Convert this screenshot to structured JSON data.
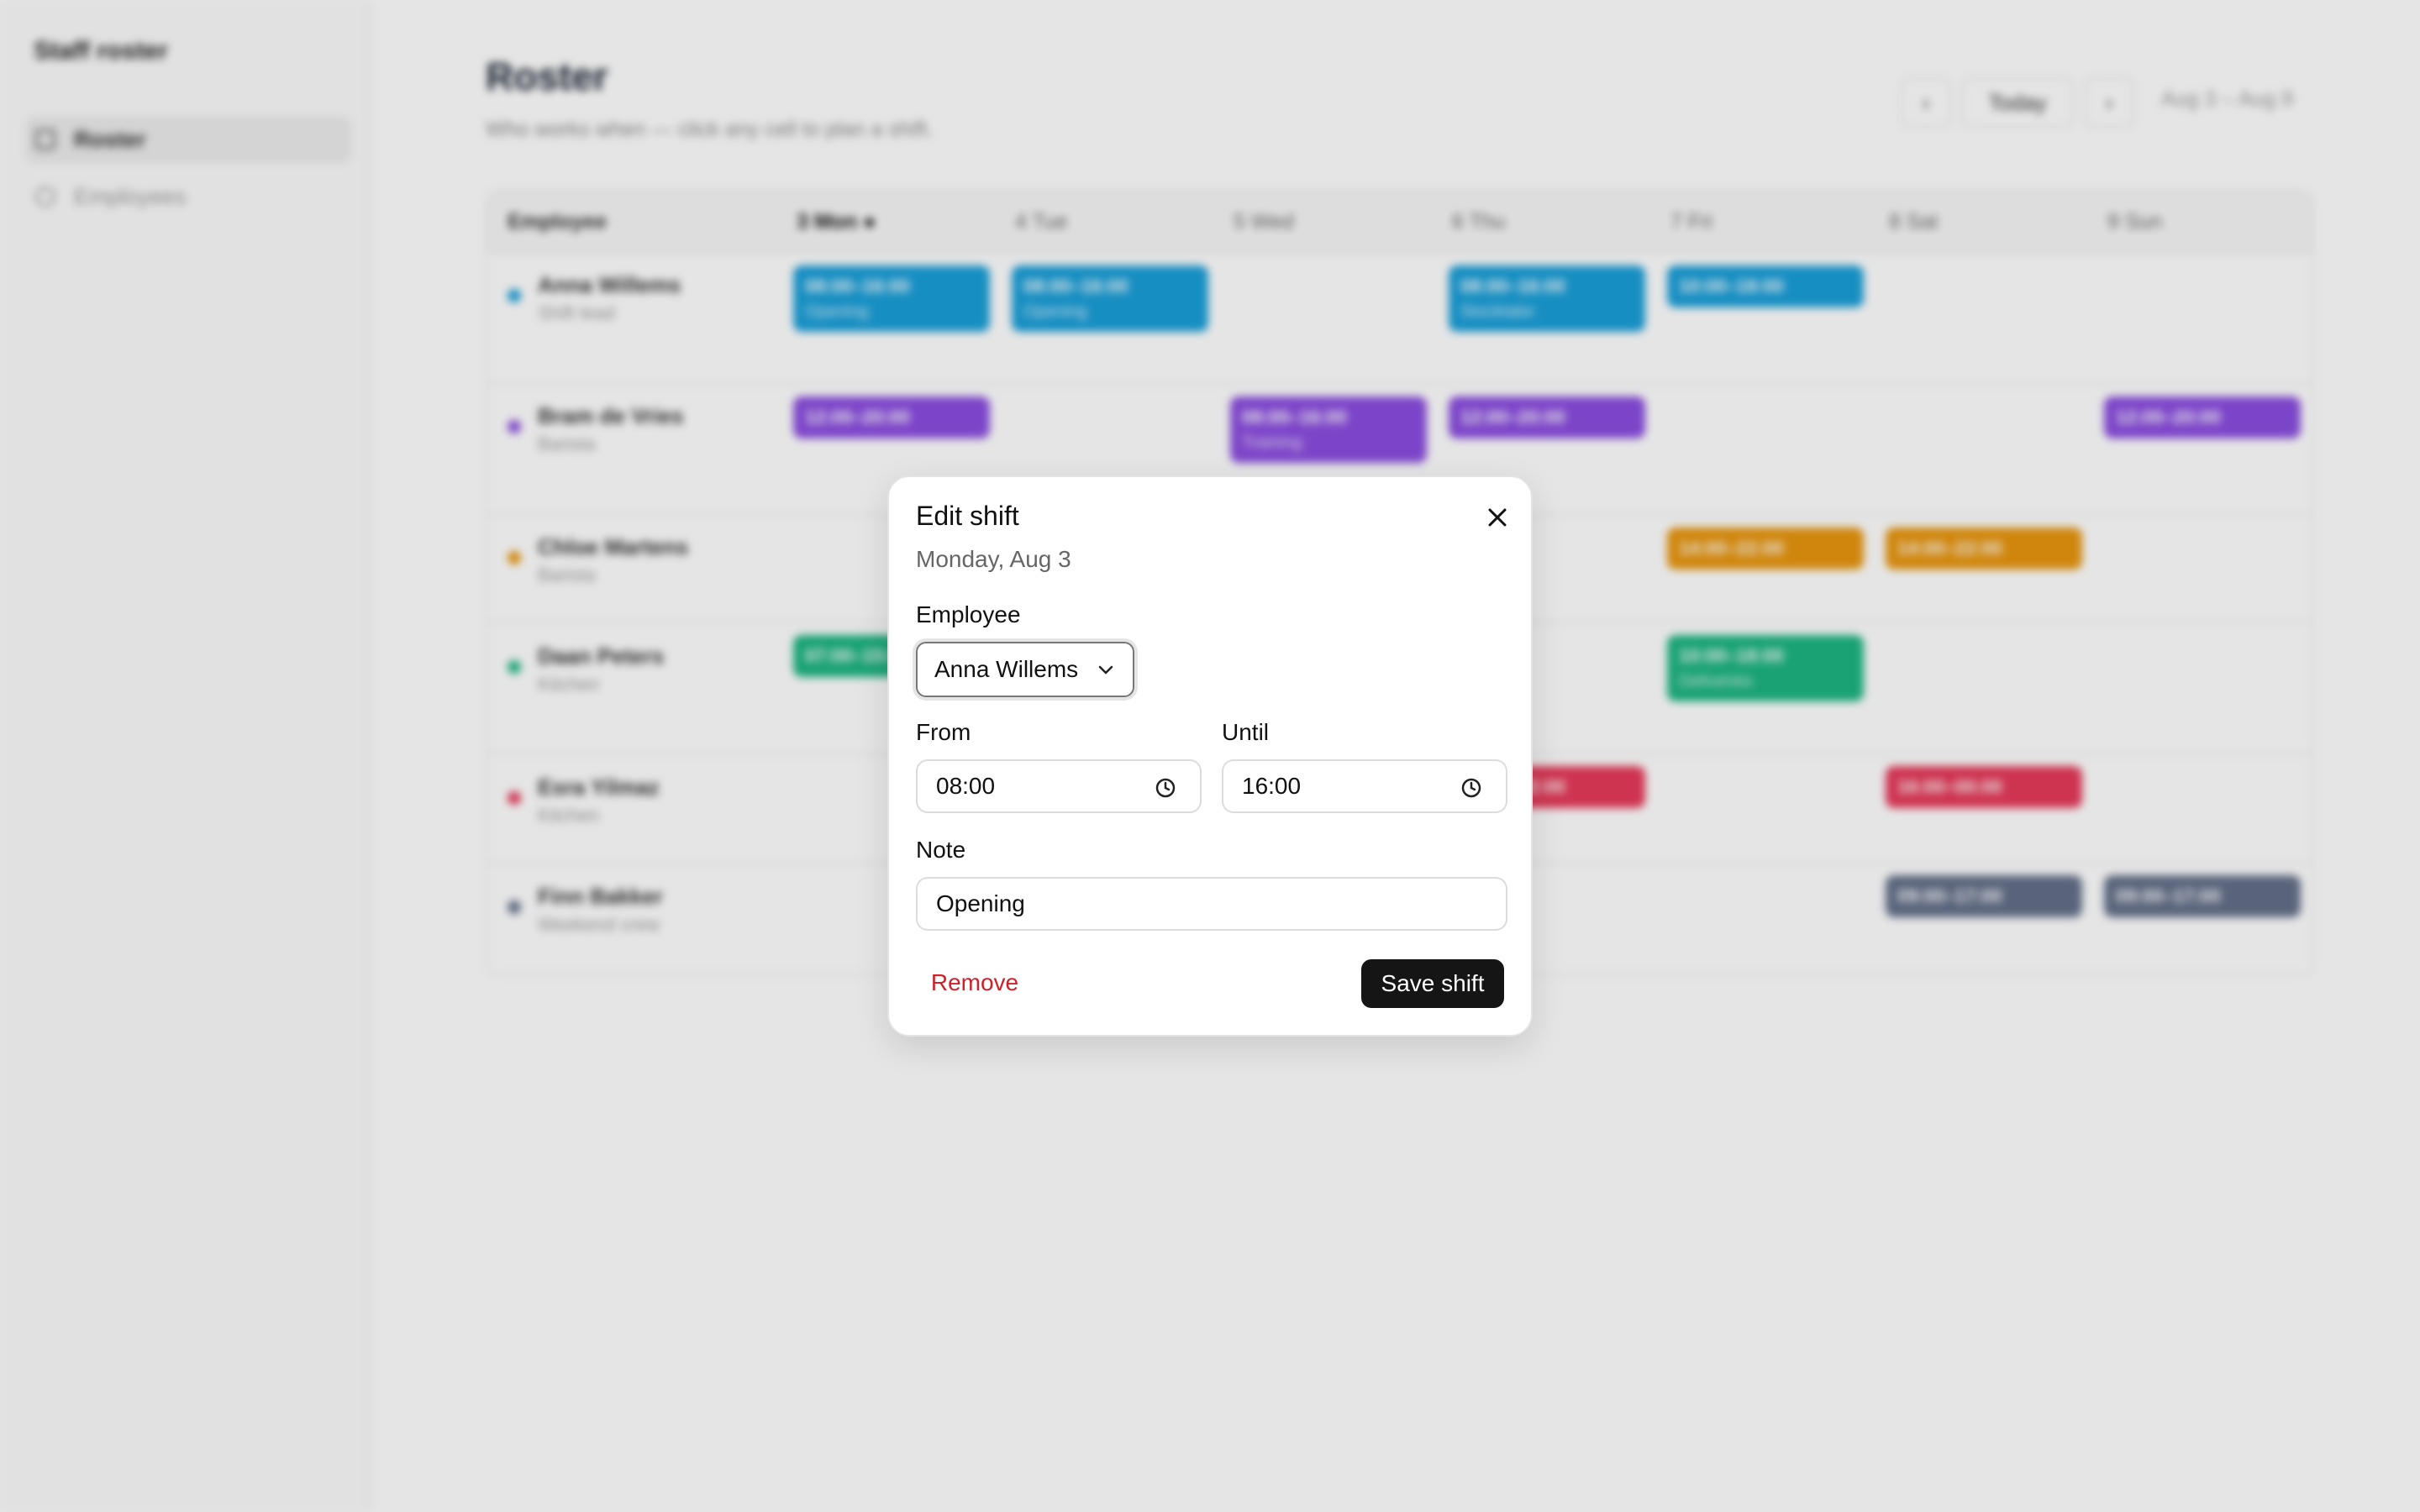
{
  "sidebar": {
    "brand": "Staff roster",
    "items": [
      {
        "label": "Roster"
      },
      {
        "label": "Employees"
      }
    ]
  },
  "header": {
    "title": "Roster",
    "subtitle": "Who works when — click any cell to plan a shift.",
    "prev": "‹",
    "today": "Today",
    "next": "›",
    "range": "Aug 3 – Aug 9"
  },
  "grid": {
    "columns": [
      "Employee",
      "3 Mon ●",
      "4 Tue",
      "5 Wed",
      "6 Thu",
      "7 Fri",
      "8 Sat",
      "9 Sun"
    ],
    "rows": [
      {
        "name": "Anna Willems",
        "role": "Shift lead"
      },
      {
        "name": "Bram de Vries",
        "role": "Barista"
      },
      {
        "name": "Chloe Martens",
        "role": "Barista"
      },
      {
        "name": "Daan Peters",
        "role": "Kitchen"
      },
      {
        "name": "Esra Yilmaz",
        "role": "Kitchen"
      },
      {
        "name": "Finn Bakker",
        "role": "Weekend crew"
      }
    ],
    "shifts": [
      {
        "time": "08:00–16:00",
        "note": "Opening"
      },
      {
        "time": "08:00–16:00",
        "note": "Opening"
      },
      {
        "time": "08:00–16:00",
        "note": "Stocktake"
      },
      {
        "time": "10:00–18:00",
        "note": ""
      },
      {
        "time": "12:00–20:00",
        "note": ""
      },
      {
        "time": "08:00–16:00",
        "note": "Training"
      },
      {
        "time": "12:00–20:00",
        "note": ""
      },
      {
        "time": "12:00–20:00",
        "note": ""
      },
      {
        "time": "14:00–22:00",
        "note": ""
      },
      {
        "time": "14:00–22:00",
        "note": ""
      },
      {
        "time": "07:00–15:00",
        "note": ""
      },
      {
        "time": "10:00–18:00",
        "note": "Deliveries"
      },
      {
        "time": "14:00–22:00",
        "note": ""
      },
      {
        "time": "16:00–00:00",
        "note": ""
      },
      {
        "time": "09:00–17:00",
        "note": ""
      },
      {
        "time": "09:00–17:00",
        "note": ""
      }
    ]
  },
  "colors": {
    "blue": "#1a9fd9",
    "purple": "#8b4de0",
    "orange": "#e8960f",
    "green": "#1db582",
    "red": "#e63a5a",
    "slate": "#64708a"
  },
  "modal": {
    "title": "Edit shift",
    "date": "Monday, Aug 3",
    "employee_label": "Employee",
    "employee_value": "Anna Willems",
    "from_label": "From",
    "from_value": "08:00",
    "until_label": "Until",
    "until_value": "16:00",
    "note_label": "Note",
    "note_value": "Opening",
    "remove_label": "Remove",
    "save_label": "Save shift",
    "close_icon": "close-icon",
    "clock_icon": "clock-icon",
    "chevron_icon": "chevron-down-icon"
  }
}
